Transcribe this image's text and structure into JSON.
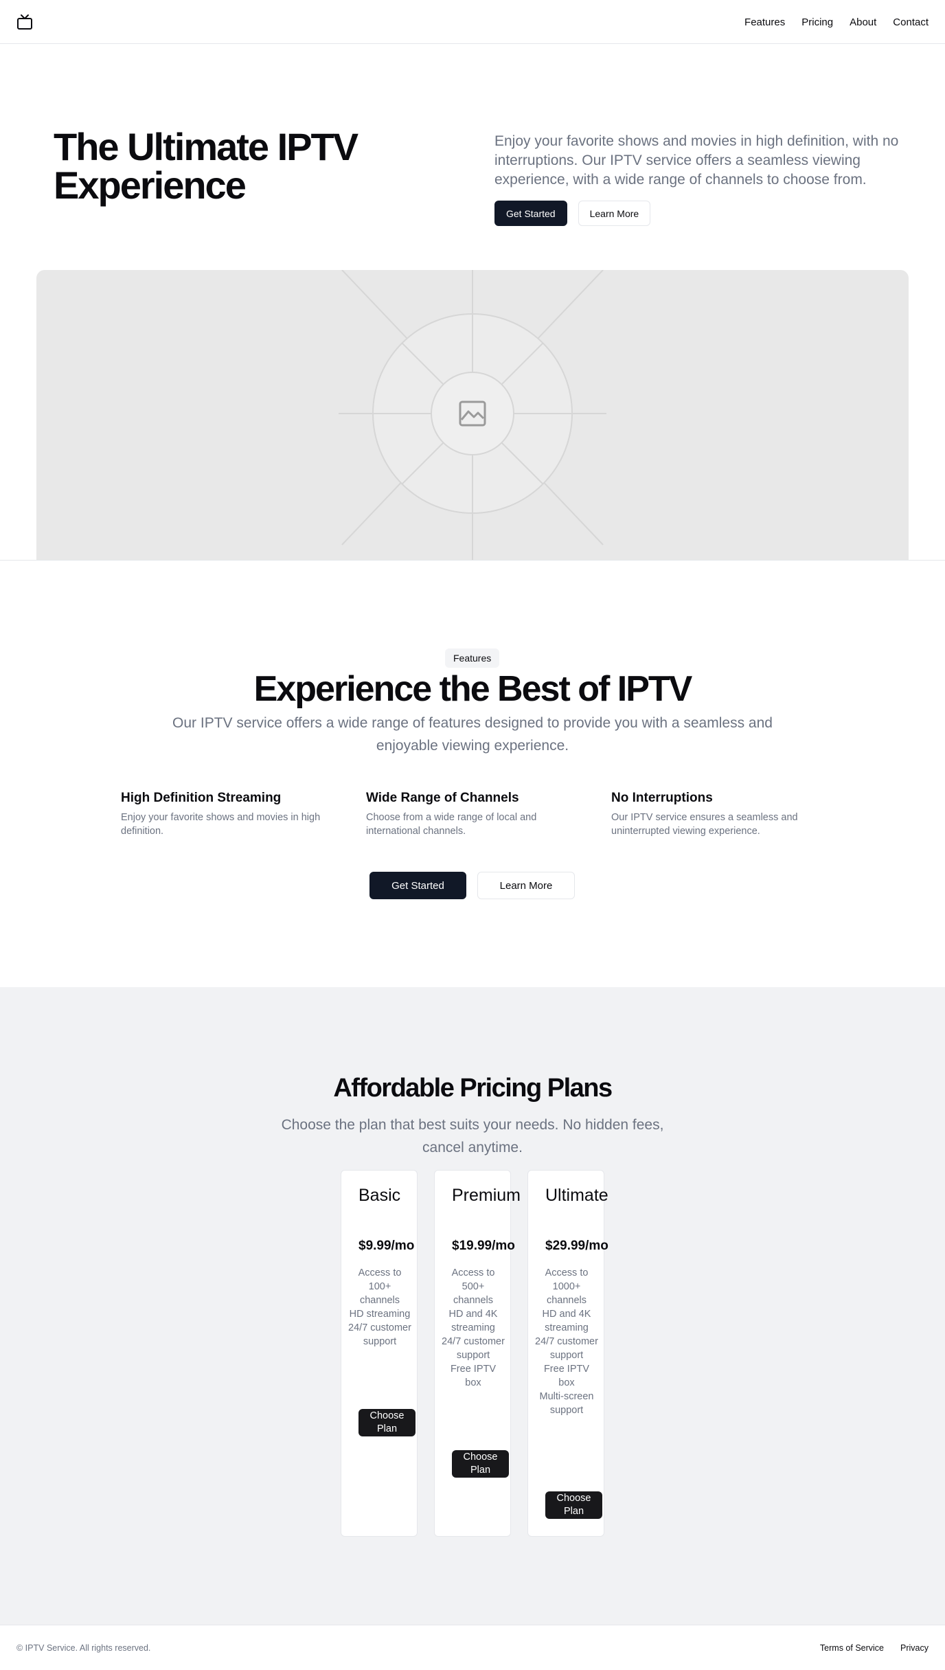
{
  "nav": {
    "logo_icon": "tv-icon",
    "links": [
      "Features",
      "Pricing",
      "About",
      "Contact"
    ]
  },
  "hero": {
    "title": "The Ultimate IPTV Experience",
    "description": "Enjoy your favorite shows and movies in high definition, with no interruptions. Our IPTV service offers a seamless viewing experience, with a wide range of channels to choose from.",
    "primary_button": "Get Started",
    "secondary_button": "Learn More",
    "image_icon": "image-placeholder-icon"
  },
  "features": {
    "badge": "Features",
    "title": "Experience the Best of IPTV",
    "subtitle": "Our IPTV service offers a wide range of features designed to provide you with a seamless and enjoyable viewing experience.",
    "items": [
      {
        "title": "High Definition Streaming",
        "text": "Enjoy your favorite shows and movies in high definition."
      },
      {
        "title": "Wide Range of Channels",
        "text": "Choose from a wide range of local and international channels."
      },
      {
        "title": "No Interruptions",
        "text": "Our IPTV service ensures a seamless and uninterrupted viewing experience."
      }
    ],
    "primary_button": "Get Started",
    "secondary_button": "Learn More"
  },
  "pricing": {
    "title": "Affordable Pricing Plans",
    "subtitle": "Choose the plan that best suits your needs. No hidden fees, cancel anytime.",
    "plans": [
      {
        "name": "Basic",
        "price": "$9.99/mo",
        "features": [
          "Access to 100+ channels",
          "HD streaming",
          "24/7 customer support"
        ],
        "button": "Choose Plan"
      },
      {
        "name": "Premium",
        "price": "$19.99/mo",
        "features": [
          "Access to 500+ channels",
          "HD and 4K streaming",
          "24/7 customer support",
          "Free IPTV box"
        ],
        "button": "Choose Plan"
      },
      {
        "name": "Ultimate",
        "price": "$29.99/mo",
        "features": [
          "Access to 1000+ channels",
          "HD and 4K streaming",
          "24/7 customer support",
          "Free IPTV box",
          "Multi-screen support"
        ],
        "button": "Choose Plan"
      }
    ]
  },
  "footer": {
    "copyright": "© IPTV Service. All rights reserved.",
    "links": [
      "Terms of Service",
      "Privacy"
    ]
  },
  "colors": {
    "primary": "#111827",
    "muted_text": "#6b7280",
    "pricing_background": "#f1f2f4",
    "placeholder_background": "#e8e8e8"
  }
}
